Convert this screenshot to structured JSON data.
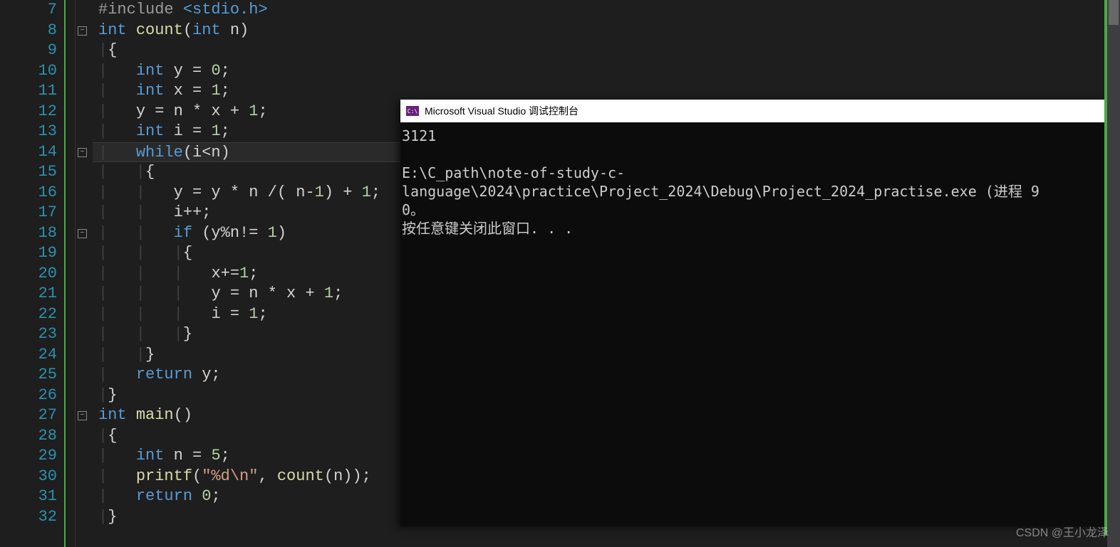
{
  "editor": {
    "first_line": 7,
    "highlighted_line": 14,
    "fold_markers": [
      {
        "line": 8,
        "symbol": "−"
      },
      {
        "line": 14,
        "symbol": "−"
      },
      {
        "line": 18,
        "symbol": "−"
      },
      {
        "line": 27,
        "symbol": "−"
      }
    ],
    "lines": [
      {
        "n": 7,
        "tokens": [
          [
            "pp",
            "#include "
          ],
          [
            "inc",
            "<stdio.h>"
          ]
        ]
      },
      {
        "n": 8,
        "tokens": [
          [
            "kw",
            "int"
          ],
          [
            "op",
            " "
          ],
          [
            "fn",
            "count"
          ],
          [
            "op",
            "("
          ],
          [
            "kw",
            "int"
          ],
          [
            "op",
            " n)"
          ]
        ]
      },
      {
        "n": 9,
        "tokens": [
          [
            "guide",
            "|"
          ],
          [
            "op",
            "{"
          ]
        ]
      },
      {
        "n": 10,
        "tokens": [
          [
            "guide",
            "|   "
          ],
          [
            "kw",
            "int"
          ],
          [
            "op",
            " y = "
          ],
          [
            "num",
            "0"
          ],
          [
            "op",
            ";"
          ]
        ]
      },
      {
        "n": 11,
        "tokens": [
          [
            "guide",
            "|   "
          ],
          [
            "kw",
            "int"
          ],
          [
            "op",
            " x = "
          ],
          [
            "num",
            "1"
          ],
          [
            "op",
            ";"
          ]
        ]
      },
      {
        "n": 12,
        "tokens": [
          [
            "guide",
            "|   "
          ],
          [
            "op",
            "y = n * x + "
          ],
          [
            "num",
            "1"
          ],
          [
            "op",
            ";"
          ]
        ]
      },
      {
        "n": 13,
        "tokens": [
          [
            "guide",
            "|   "
          ],
          [
            "kw",
            "int"
          ],
          [
            "op",
            " i = "
          ],
          [
            "num",
            "1"
          ],
          [
            "op",
            ";"
          ]
        ]
      },
      {
        "n": 14,
        "tokens": [
          [
            "guide",
            "|   "
          ],
          [
            "kw",
            "while"
          ],
          [
            "op",
            "(i<n)"
          ]
        ]
      },
      {
        "n": 15,
        "tokens": [
          [
            "guide",
            "|   |"
          ],
          [
            "op",
            "{"
          ]
        ]
      },
      {
        "n": 16,
        "tokens": [
          [
            "guide",
            "|   |   "
          ],
          [
            "op",
            "y = y * n /( n-"
          ],
          [
            "num",
            "1"
          ],
          [
            "op",
            ") + "
          ],
          [
            "num",
            "1"
          ],
          [
            "op",
            ";"
          ]
        ]
      },
      {
        "n": 17,
        "tokens": [
          [
            "guide",
            "|   |   "
          ],
          [
            "op",
            "i++;"
          ]
        ]
      },
      {
        "n": 18,
        "tokens": [
          [
            "guide",
            "|   |   "
          ],
          [
            "kw",
            "if"
          ],
          [
            "op",
            " (y%n!= "
          ],
          [
            "num",
            "1"
          ],
          [
            "op",
            ")"
          ]
        ]
      },
      {
        "n": 19,
        "tokens": [
          [
            "guide",
            "|   |   |"
          ],
          [
            "op",
            "{"
          ]
        ]
      },
      {
        "n": 20,
        "tokens": [
          [
            "guide",
            "|   |   |   "
          ],
          [
            "op",
            "x+="
          ],
          [
            "num",
            "1"
          ],
          [
            "op",
            ";"
          ]
        ]
      },
      {
        "n": 21,
        "tokens": [
          [
            "guide",
            "|   |   |   "
          ],
          [
            "op",
            "y = n * x + "
          ],
          [
            "num",
            "1"
          ],
          [
            "op",
            ";"
          ]
        ]
      },
      {
        "n": 22,
        "tokens": [
          [
            "guide",
            "|   |   |   "
          ],
          [
            "op",
            "i = "
          ],
          [
            "num",
            "1"
          ],
          [
            "op",
            ";"
          ]
        ]
      },
      {
        "n": 23,
        "tokens": [
          [
            "guide",
            "|   |   |"
          ],
          [
            "op",
            "}"
          ]
        ]
      },
      {
        "n": 24,
        "tokens": [
          [
            "guide",
            "|   |"
          ],
          [
            "op",
            "}"
          ]
        ]
      },
      {
        "n": 25,
        "tokens": [
          [
            "guide",
            "|   "
          ],
          [
            "kw",
            "return"
          ],
          [
            "op",
            " y;"
          ]
        ]
      },
      {
        "n": 26,
        "tokens": [
          [
            "guide",
            "|"
          ],
          [
            "op",
            "}"
          ]
        ]
      },
      {
        "n": 27,
        "tokens": [
          [
            "kw",
            "int"
          ],
          [
            "op",
            " "
          ],
          [
            "fn",
            "main"
          ],
          [
            "op",
            "()"
          ]
        ]
      },
      {
        "n": 28,
        "tokens": [
          [
            "guide",
            "|"
          ],
          [
            "op",
            "{"
          ]
        ]
      },
      {
        "n": 29,
        "tokens": [
          [
            "guide",
            "|   "
          ],
          [
            "kw",
            "int"
          ],
          [
            "op",
            " n = "
          ],
          [
            "num",
            "5"
          ],
          [
            "op",
            ";"
          ]
        ]
      },
      {
        "n": 30,
        "tokens": [
          [
            "guide",
            "|   "
          ],
          [
            "fn",
            "printf"
          ],
          [
            "op",
            "("
          ],
          [
            "str",
            "\"%d\\n\""
          ],
          [
            "op",
            ", "
          ],
          [
            "fn",
            "count"
          ],
          [
            "op",
            "(n));"
          ]
        ]
      },
      {
        "n": 31,
        "tokens": [
          [
            "guide",
            "|   "
          ],
          [
            "kw",
            "return"
          ],
          [
            "op",
            " "
          ],
          [
            "num",
            "0"
          ],
          [
            "op",
            ";"
          ]
        ]
      },
      {
        "n": 32,
        "tokens": [
          [
            "guide",
            "|"
          ],
          [
            "op",
            "}"
          ]
        ]
      }
    ]
  },
  "console": {
    "title": "Microsoft Visual Studio 调试控制台",
    "icon_text": "C:\\",
    "output": "3121\n\nE:\\C_path\\note-of-study-c-language\\2024\\practice\\Project_2024\\Debug\\Project_2024_practise.exe (进程 9\n0。\n按任意键关闭此窗口. . ."
  },
  "watermark": "CSDN @王小龙泽"
}
